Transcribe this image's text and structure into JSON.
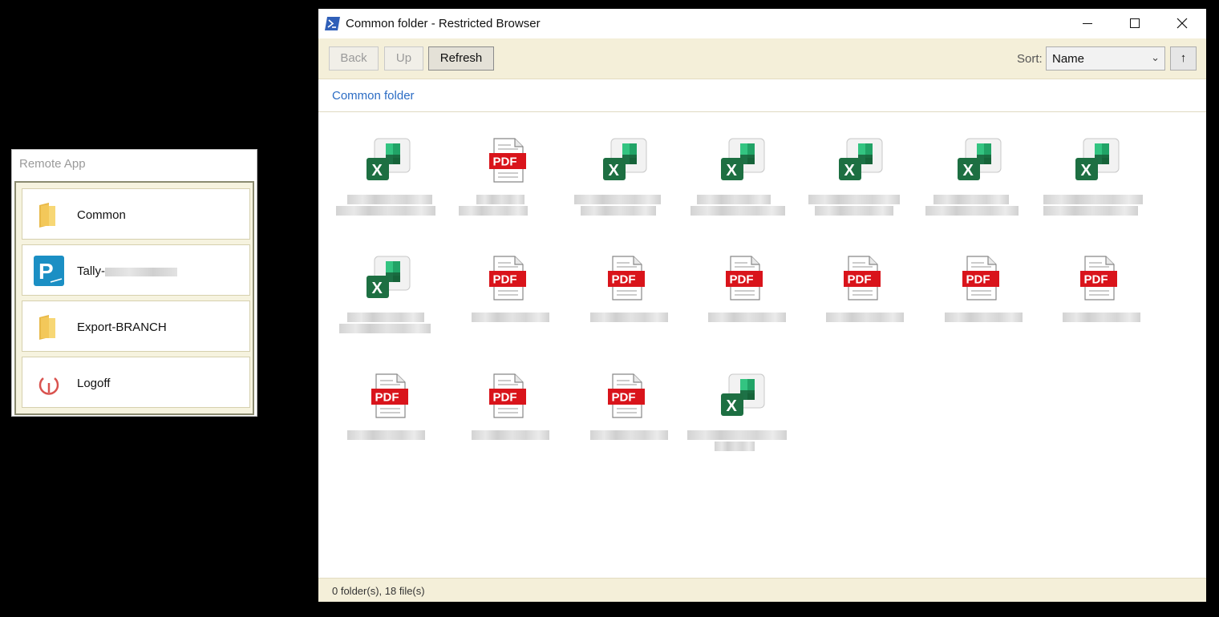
{
  "remote_app": {
    "title": "Remote App",
    "items": [
      {
        "label": "Common",
        "icon": "folder-icon"
      },
      {
        "label": "Tally-",
        "icon": "tally-prime-icon"
      },
      {
        "label": "Export-BRANCH",
        "icon": "folder-icon"
      },
      {
        "label": "Logoff",
        "icon": "power-icon"
      }
    ]
  },
  "window": {
    "title": "Common folder - Restricted Browser",
    "icon": "powershell-icon"
  },
  "toolbar": {
    "back_label": "Back",
    "up_label": "Up",
    "refresh_label": "Refresh",
    "sort_label": "Sort:",
    "sort_value": "Name",
    "sort_direction": "↑"
  },
  "breadcrumb": {
    "current": "Common folder"
  },
  "files": [
    {
      "type": "excel"
    },
    {
      "type": "pdf"
    },
    {
      "type": "excel"
    },
    {
      "type": "excel"
    },
    {
      "type": "excel"
    },
    {
      "type": "excel"
    },
    {
      "type": "excel"
    },
    {
      "type": "excel"
    },
    {
      "type": "pdf"
    },
    {
      "type": "pdf"
    },
    {
      "type": "pdf"
    },
    {
      "type": "pdf"
    },
    {
      "type": "pdf"
    },
    {
      "type": "pdf"
    },
    {
      "type": "pdf"
    },
    {
      "type": "pdf"
    },
    {
      "type": "pdf"
    },
    {
      "type": "excel"
    }
  ],
  "status": {
    "text": "0 folder(s), 18 file(s)"
  },
  "colors": {
    "toolbar_bg": "#f4efd9",
    "link": "#2b6cc4",
    "pdf_red": "#d9141b",
    "excel_green": "#1d6f42"
  }
}
